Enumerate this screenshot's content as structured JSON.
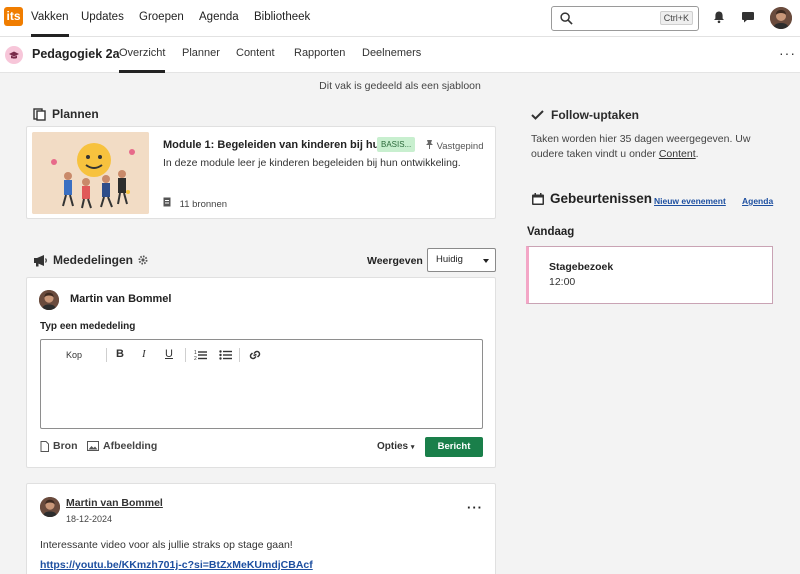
{
  "topnav": {
    "logo": "its",
    "items": [
      {
        "label": "Vakken",
        "active": true
      },
      {
        "label": "Updates"
      },
      {
        "label": "Groepen"
      },
      {
        "label": "Agenda"
      },
      {
        "label": "Bibliotheek"
      }
    ],
    "search": {
      "placeholder": "",
      "shortcut": "Ctrl+K"
    },
    "icons": [
      "bell-icon",
      "chat-icon",
      "user-avatar"
    ]
  },
  "course": {
    "title": "Pedagogiek 2a",
    "tabs": [
      {
        "label": "Overzicht",
        "active": true
      },
      {
        "label": "Planner"
      },
      {
        "label": "Content"
      },
      {
        "label": "Rapporten"
      },
      {
        "label": "Deelnemers"
      }
    ],
    "template_note": "Dit vak is gedeeld als een sjabloon"
  },
  "plans": {
    "heading": "Plannen",
    "module": {
      "title": "Module 1: Begeleiden van kinderen bij hun ...",
      "badge": "BASIS...",
      "pinned": "Vastgepind",
      "description": "In deze module leer je kinderen begeleiden bij hun ontwikkeling.",
      "sources": "11 bronnen"
    }
  },
  "announcements": {
    "heading": "Mededelingen",
    "show_label": "Weergeven",
    "show_value": "Huidig",
    "composer": {
      "author": "Martin van Bommel",
      "label": "Typ een mededeling",
      "toolbar": {
        "heading": "Kop",
        "bold": "B",
        "italic": "I",
        "underline": "U"
      },
      "source": "Bron",
      "image": "Afbeelding",
      "options": "Opties",
      "post": "Bericht"
    },
    "post": {
      "author": "Martin van Bommel",
      "date": "18-12-2024",
      "text": "Interessante video voor als jullie straks op stage gaan!",
      "link": "https://youtu.be/KKmzh701j-c?si=BtZxMeKUmdjCBAcf"
    }
  },
  "follow": {
    "heading": "Follow-uptaken",
    "text_before": "Taken worden hier 35 dagen weergegeven. Uw oudere taken vindt u onder ",
    "link": "Content",
    "text_after": "."
  },
  "events": {
    "heading": "Gebeurtenissen",
    "new_event": "Nieuw evenement",
    "agenda": "Agenda",
    "today": "Vandaag",
    "items": [
      {
        "title": "Stagebezoek",
        "time": "12:00"
      }
    ]
  },
  "colors": {
    "logo": "#f07d00",
    "post_button": "#1a7f4a",
    "badge": "#c8efcf",
    "event_accent": "#f3a6c6",
    "link": "#1d4fa0"
  }
}
